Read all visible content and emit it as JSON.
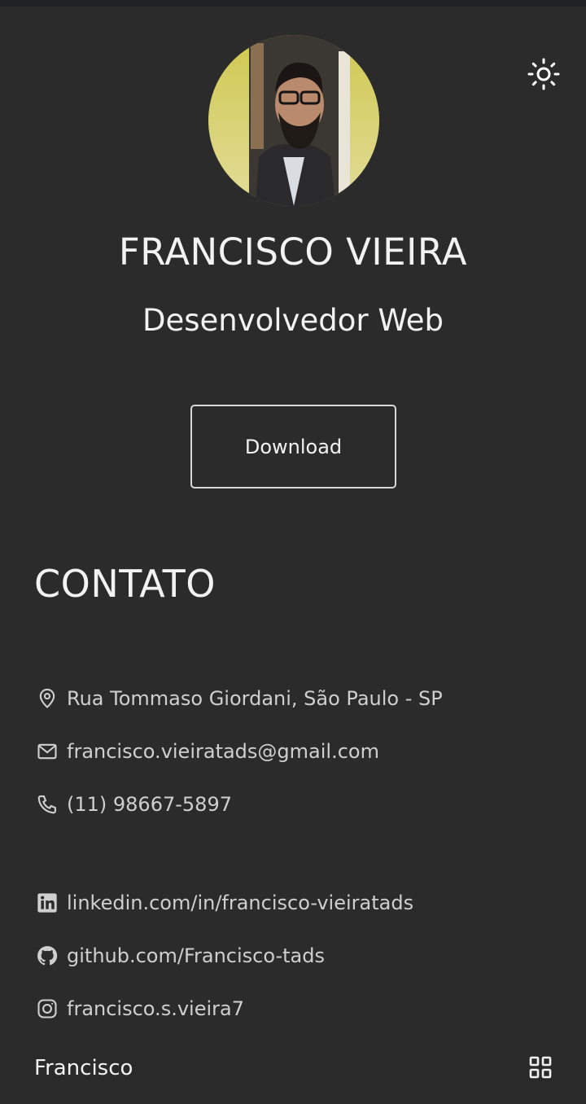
{
  "profile": {
    "name": "FRANCISCO VIEIRA",
    "title": "Desenvolvedor Web",
    "download_label": "Download",
    "photo_icon": "profile-photo"
  },
  "contact": {
    "heading": "CONTATO",
    "items": [
      {
        "icon": "map-pin-icon",
        "text": "Rua Tommaso Giordani, São Paulo - SP"
      },
      {
        "icon": "mail-icon",
        "text": "francisco.vieiratads@gmail.com"
      },
      {
        "icon": "phone-icon",
        "text": "(11) 98667-5897"
      },
      {
        "icon": "linkedin-icon",
        "text": "linkedin.com/in/francisco-vieiratads"
      },
      {
        "icon": "github-icon",
        "text": "github.com/Francisco-tads"
      },
      {
        "icon": "instagram-icon",
        "text": "francisco.s.vieira7"
      }
    ]
  },
  "nav": {
    "logo": "Francisco",
    "menu_icon": "grid-menu-icon"
  },
  "header": {
    "theme_icon": "sun-icon"
  },
  "colors": {
    "background": "#2b2b2b",
    "text": "#f2f2f2",
    "muted": "#cfcfcf",
    "avatar_bg": "#d6d06a"
  }
}
